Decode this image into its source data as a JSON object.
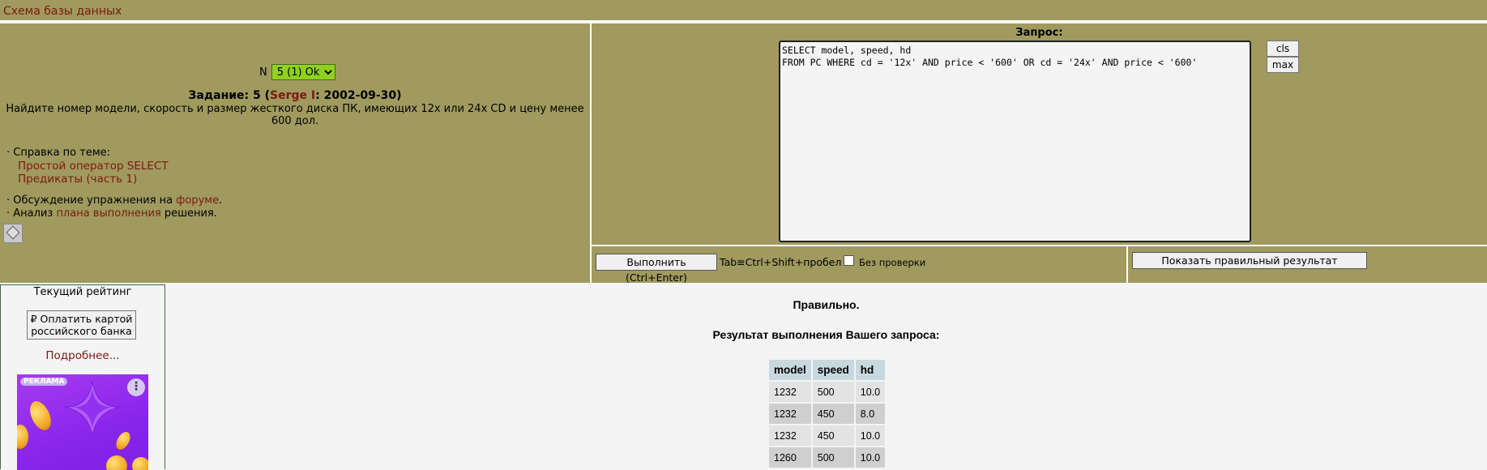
{
  "topbar": {
    "schema_link": "Схема базы данных"
  },
  "task": {
    "n_label": "N",
    "n_select_value": "5 (1) Ok",
    "title_prefix": "Задание: 5 (",
    "author": "Serge I",
    "title_suffix": ": 2002-09-30)",
    "description": "Найдите номер модели, скорость и размер жесткого диска ПК, имеющих 12x или 24x CD и цену менее 600 дол.",
    "help_heading": "· Справка по теме:",
    "help_links": [
      "Простой оператор SELECT",
      "Предикаты (часть 1)"
    ],
    "forum_prefix": "· Обсуждение упражнения на ",
    "forum_link": "форуме",
    "forum_suffix": ".",
    "plan_prefix": "· Анализ ",
    "plan_link": "плана выполнения",
    "plan_suffix": " решения."
  },
  "query": {
    "label": "Запрос:",
    "text": "SELECT model, speed, hd\nFROM PC WHERE cd = '12x' AND price < '600' OR cd = '24x' AND price < '600'",
    "cls_label": "cls",
    "max_label": "max",
    "execute_label": "Выполнить (Ctrl+Enter)",
    "tab_hint": "Tab≡Ctrl+Shift+пробел",
    "no_check_label": "Без  проверки",
    "no_check_checked": false,
    "show_result_label": "Показать правильный результат"
  },
  "rating": {
    "title": "Текущий рейтинг",
    "pay_button": "₽ Оплатить картой российского банка",
    "more_link": "Подробнее...",
    "ad_badge": "РЕКЛАМА",
    "ad_menu": "⋮"
  },
  "result": {
    "status": "Правильно.",
    "title": "Результат выполнения Вашего запроса:",
    "columns": [
      "model",
      "speed",
      "hd"
    ],
    "rows": [
      [
        "1232",
        "500",
        "10.0"
      ],
      [
        "1232",
        "450",
        "8.0"
      ],
      [
        "1232",
        "450",
        "10.0"
      ],
      [
        "1260",
        "500",
        "10.0"
      ]
    ]
  },
  "colors": {
    "panel": "#a09a5f",
    "link": "#7a1a0e",
    "select_ok": "#8fd11e",
    "header_cell": "#c7d8de"
  }
}
